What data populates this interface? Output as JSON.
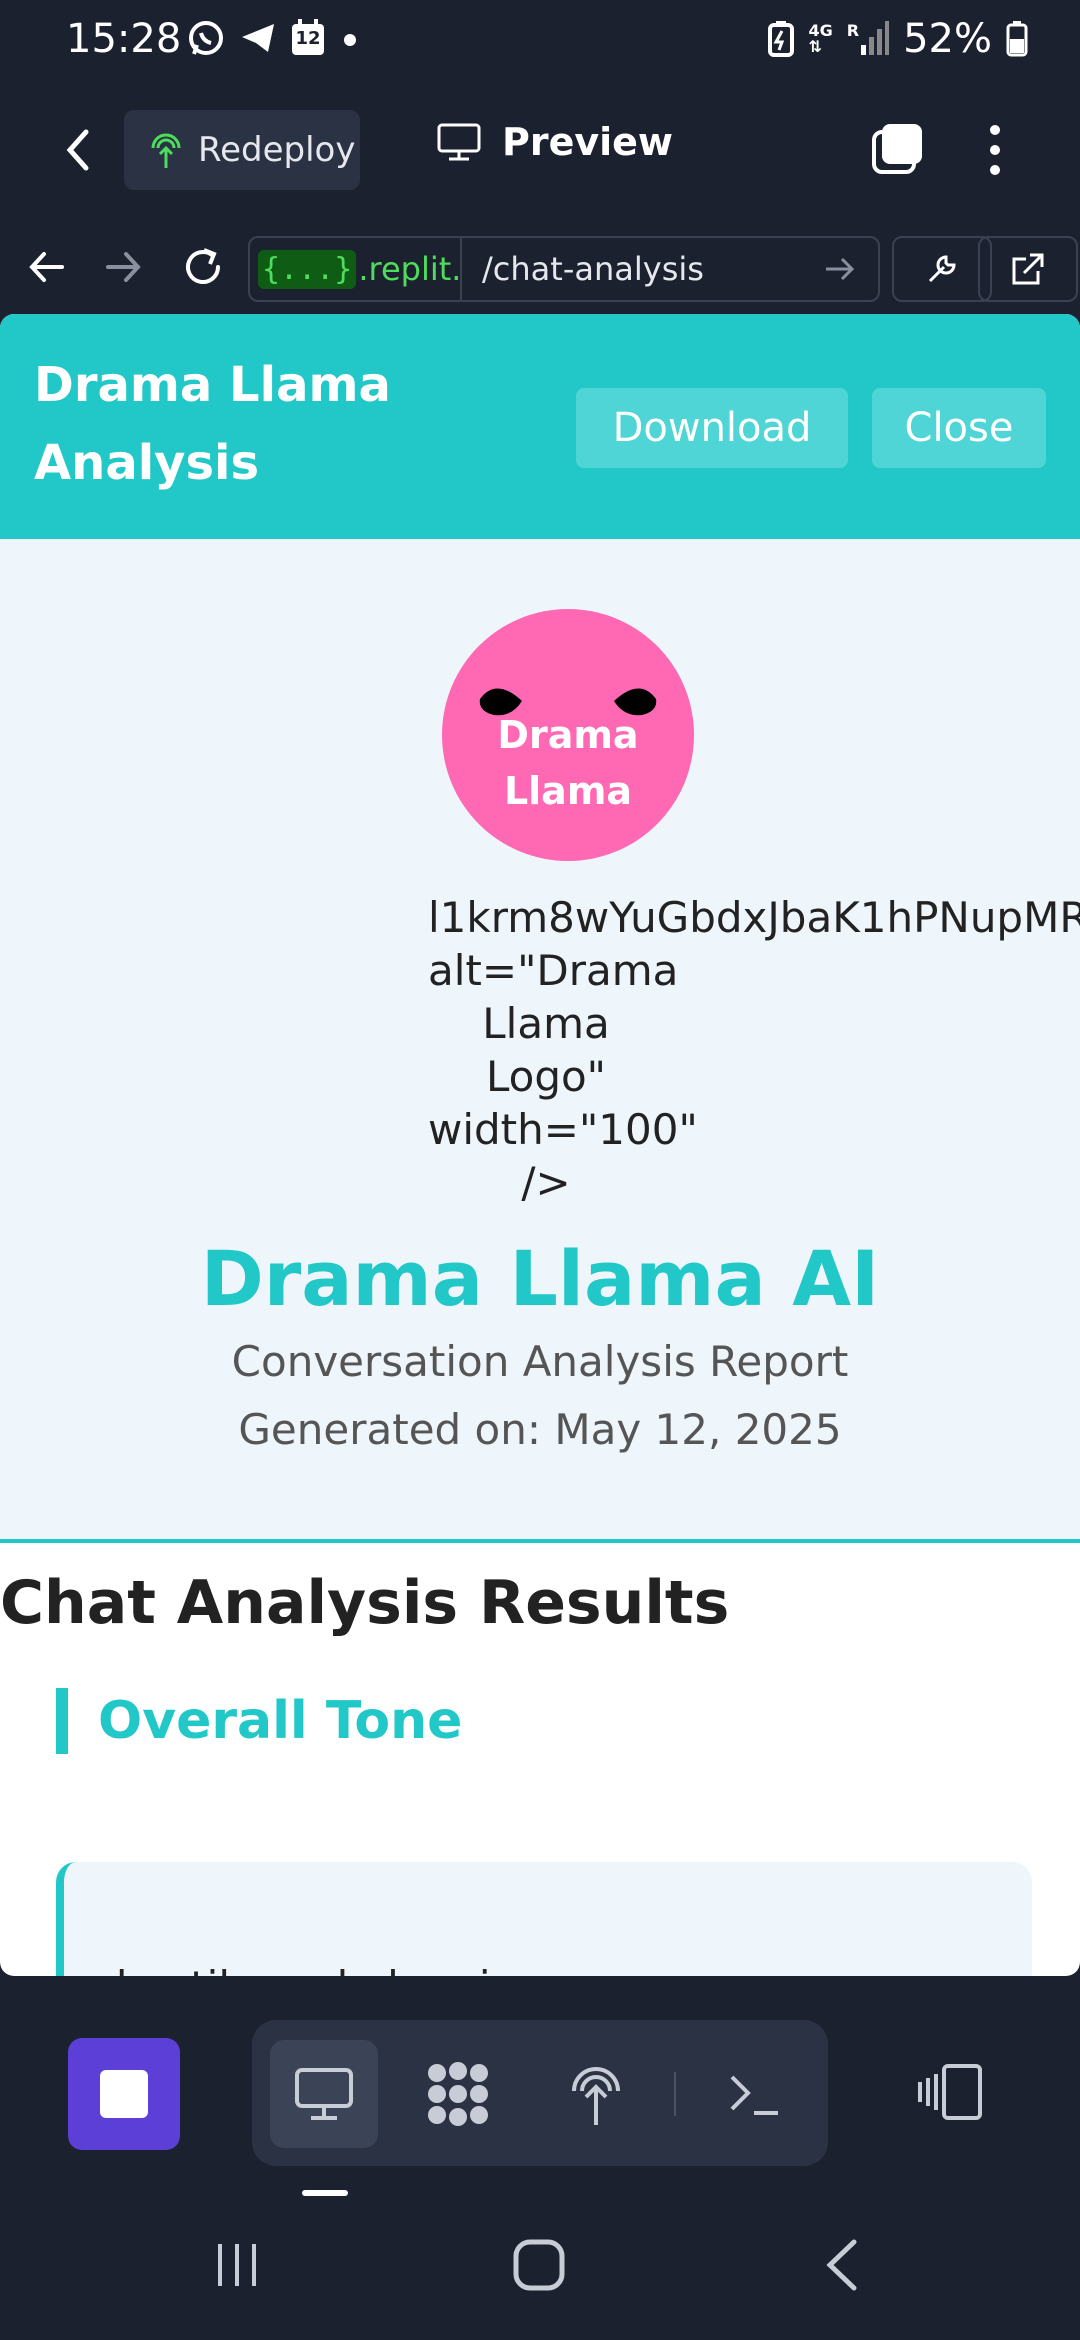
{
  "status_bar": {
    "time": "15:28",
    "calendar_date": "12",
    "network": "4G",
    "roaming": "R",
    "battery": "52%"
  },
  "top_bar": {
    "redeploy_label": "Redeploy",
    "preview_label": "Preview"
  },
  "url_bar": {
    "badge": "{...}",
    "domain": ".replit.de",
    "path": "/chat-analysis"
  },
  "page": {
    "title_line1": "Drama Llama",
    "title_line2": "Analysis",
    "download_label": "Download",
    "close_label": "Close",
    "logo_line1": "Drama",
    "logo_line2": "Llama",
    "broken_image_text": [
      "l1krm8wYuGbdxJbaK1hPNupMR",
      "alt=\"Drama",
      "Llama",
      "Logo\"",
      "width=\"100\"",
      "/>"
    ],
    "brand": "Drama Llama AI",
    "subtitle": "Conversation Analysis Report",
    "generated": "Generated on: May 12, 2025",
    "results_title": "Chat Analysis Results",
    "section_title": "Overall Tone",
    "tone_text": "hostile and abrasive"
  },
  "colors": {
    "accent_teal": "#22c7c7",
    "logo_pink": "#ff69b4",
    "stop_purple": "#5c3fd6",
    "chrome_dark": "#1c2130"
  },
  "icons": {
    "bottom_tools": [
      "monitor-icon",
      "apps-icon",
      "deploy-icon",
      "terminal-icon"
    ]
  }
}
